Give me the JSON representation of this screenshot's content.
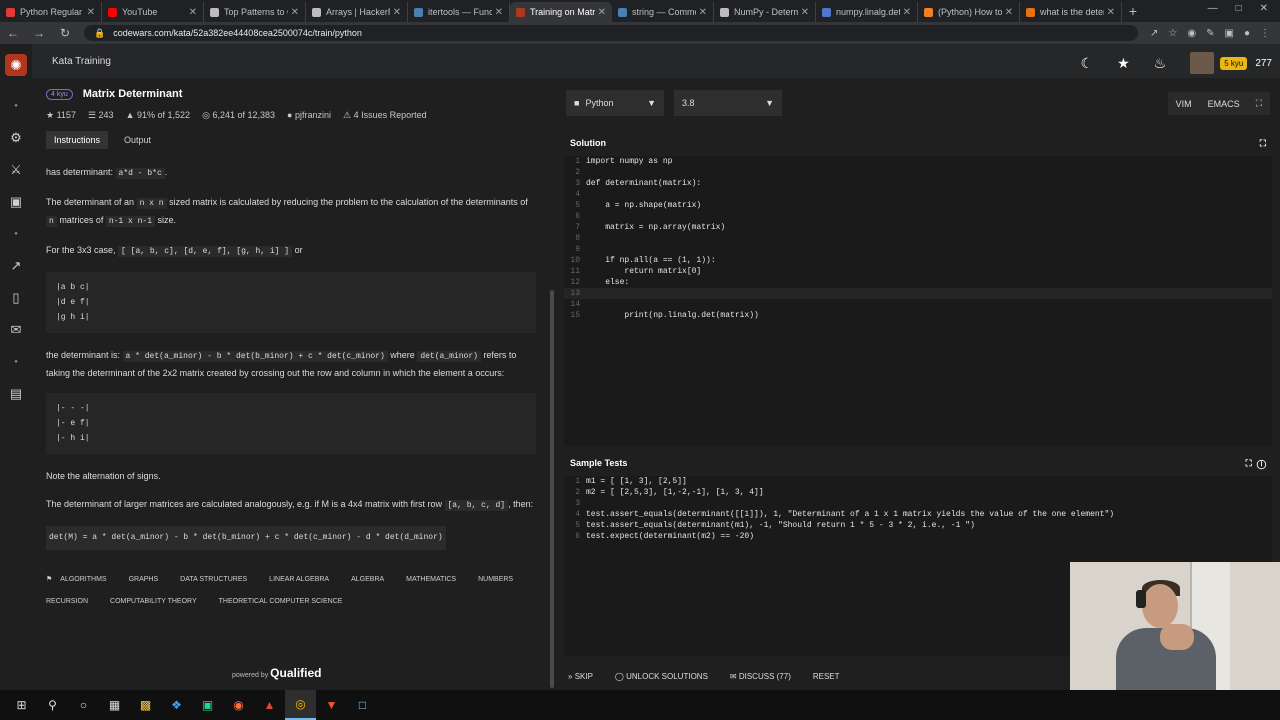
{
  "browser": {
    "tabs": [
      {
        "title": "Python Regular Ex",
        "color": "#e53935"
      },
      {
        "title": "YouTube",
        "color": "#ff0000"
      },
      {
        "title": "Top Patterns to Co",
        "color": "#bdbdbd"
      },
      {
        "title": "Arrays | HackerRa",
        "color": "#bdbdbd"
      },
      {
        "title": "itertools — Functi",
        "color": "#4a7fb5"
      },
      {
        "title": "Training on Matri",
        "color": "#b1361e",
        "active": true
      },
      {
        "title": "string — Commo",
        "color": "#4a7fb5"
      },
      {
        "title": "NumPy - Determ",
        "color": "#bdbdbd"
      },
      {
        "title": "numpy.linalg.det",
        "color": "#4d77cf"
      },
      {
        "title": "(Python) How to u",
        "color": "#f48024"
      },
      {
        "title": "what is the determ",
        "color": "#e8710a"
      }
    ],
    "url": "codewars.com/kata/52a382ee44408cea2500074c/train/python"
  },
  "header": {
    "breadcrumb": "Kata Training",
    "kyu_badge": "5 kyu",
    "honor": "277"
  },
  "kata": {
    "rank": "4 kyu",
    "title": "Matrix Determinant",
    "stats": {
      "stars": "1157",
      "collections": "243",
      "satisfaction": "91% of 1,522",
      "completed": "6,241 of 12,383",
      "author": "pjfranzini",
      "issues": "4 Issues Reported"
    },
    "tabs": [
      "Instructions",
      "Output"
    ]
  },
  "description": {
    "p1_pre": "has determinant: ",
    "p1_code": "a*d - b*c",
    "p1_post": ".",
    "p2_a": "The determinant of an ",
    "p2_code1": "n x n",
    "p2_b": " sized matrix is calculated by reducing the problem to the calculation of the determinants of ",
    "p2_code2": "n",
    "p2_c": " matrices of ",
    "p2_code3": "n-1 x n-1",
    "p2_d": " size.",
    "p3_pre": "For the 3x3 case, ",
    "p3_code": "[ [a, b, c], [d, e, f], [g, h, i] ]",
    "p3_post": " or",
    "block1": [
      "|a b c|",
      "|d e f|",
      "|g h i|"
    ],
    "p4_a": "the determinant is: ",
    "p4_code1": "a * det(a_minor) - b * det(b_minor) + c * det(c_minor)",
    "p4_b": " where ",
    "p4_code2": "det(a_minor)",
    "p4_c": " refers to taking the determinant of the 2x2 matrix created by crossing out the row and column in which the element a occurs:",
    "block2": [
      "|- - -|",
      "|- e f|",
      "|- h i|"
    ],
    "p5": "Note the alternation of signs.",
    "p6_a": "The determinant of larger matrices are calculated analogously, e.g. if M is a 4x4 matrix with first row ",
    "p6_code": "[a, b, c, d]",
    "p6_b": ", then:",
    "formula": "det(M) = a * det(a_minor) - b * det(b_minor) + c * det(c_minor) - d * det(d_minor)",
    "tags": [
      "ALGORITHMS",
      "GRAPHS",
      "DATA STRUCTURES",
      "LINEAR ALGEBRA",
      "ALGEBRA",
      "MATHEMATICS",
      "NUMBERS",
      "RECURSION",
      "COMPUTABILITY THEORY",
      "THEORETICAL COMPUTER SCIENCE"
    ],
    "powered_by": "powered by",
    "powered_brand": "Qualified"
  },
  "editor": {
    "language": "Python",
    "version": "3.8",
    "modes": [
      "VIM",
      "EMACS"
    ],
    "solution_label": "Solution",
    "solution_lines": [
      "import numpy as np",
      "",
      "def determinant(matrix):",
      "",
      "    a = np.shape(matrix)",
      "",
      "    matrix = np.array(matrix)",
      "",
      "",
      "    if np.all(a == (1, 1)):",
      "        return matrix[0]",
      "    else:",
      "",
      "",
      "        print(np.linalg.det(matrix))"
    ],
    "tests_label": "Sample Tests",
    "test_lines": [
      "m1 = [ [1, 3], [2,5]]",
      "m2 = [ [2,5,3], [1,-2,-1], [1, 3, 4]]",
      "",
      "test.assert_equals(determinant([[1]]), 1, \"Determinant of a 1 x 1 matrix yields the value of the one element\")",
      "test.assert_equals(determinant(m1), -1, \"Should return 1 * 5 - 3 * 2, i.e., -1 \")",
      "test.expect(determinant(m2) == -20)"
    ],
    "actions": [
      "SKIP",
      "UNLOCK SOLUTIONS",
      "DISCUSS (77)",
      "RESET"
    ]
  }
}
